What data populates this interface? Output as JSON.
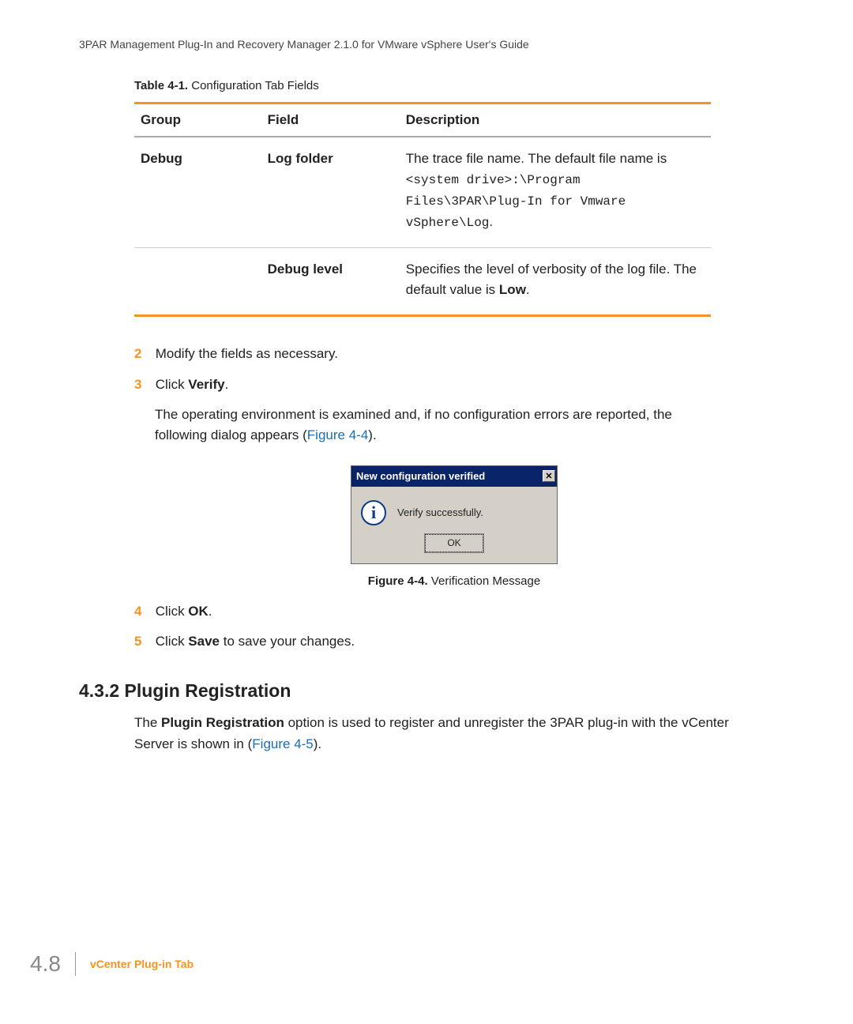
{
  "header": "3PAR Management Plug-In and Recovery Manager 2.1.0 for VMware vSphere User's Guide",
  "table_caption_bold": "Table 4-1.",
  "table_caption_rest": "  Configuration Tab Fields",
  "table": {
    "headers": {
      "group": "Group",
      "field": "Field",
      "desc": "Description"
    },
    "rows": [
      {
        "group": "Debug",
        "field": "Log folder",
        "desc_pre": "The trace file name. The default file name is ",
        "desc_mono": "<system drive>:\\Program Files\\3PAR\\Plug-In for Vmware vSphere\\Log",
        "desc_post": "."
      },
      {
        "group": "",
        "field": "Debug level",
        "desc_pre": "Specifies the level of verbosity of the log file. The default value is ",
        "desc_bold": "Low",
        "desc_post": "."
      }
    ]
  },
  "steps": {
    "s2": {
      "num": "2",
      "text": "Modify the fields as necessary."
    },
    "s3": {
      "num": "3",
      "pre": "Click ",
      "bold": "Verify",
      "post": "."
    },
    "s3body_pre": "The operating environment is examined and, if no configuration errors are reported, the following dialog appears (",
    "s3body_link": "Figure 4-4",
    "s3body_post": ").",
    "s4": {
      "num": "4",
      "pre": "Click ",
      "bold": "OK",
      "post": "."
    },
    "s5": {
      "num": "5",
      "pre": "Click ",
      "bold": "Save",
      "post": " to save your changes."
    }
  },
  "dialog": {
    "title": "New configuration verified",
    "close": "✕",
    "icon": "i",
    "message": "Verify successfully.",
    "ok": "OK"
  },
  "figure_caption_bold": "Figure 4-4.",
  "figure_caption_rest": "  Verification Message",
  "section": {
    "heading": "4.3.2 Plugin Registration",
    "para_pre": "The ",
    "para_bold": "Plugin Registration",
    "para_mid": " option is used to register and unregister the 3PAR plug-in with the vCenter Server is shown in (",
    "para_link": "Figure 4-5",
    "para_post": ")."
  },
  "footer": {
    "page": "4.8",
    "label": "vCenter Plug-in Tab"
  }
}
